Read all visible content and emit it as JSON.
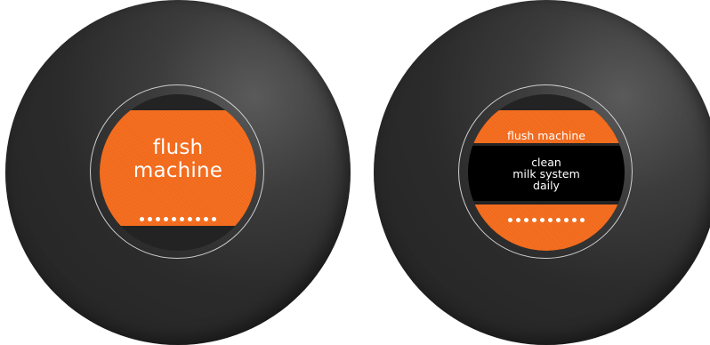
{
  "left_screen": {
    "title_line1": "flush",
    "title_line2": "machine",
    "dot_count": 10
  },
  "right_screen": {
    "header": "flush  machine",
    "message": [
      "clean",
      "milk system",
      "daily"
    ],
    "dot_count": 10
  },
  "colors": {
    "accent": "#f26a1b",
    "dial": "#2b2b2b",
    "message_bg": "#000000"
  }
}
